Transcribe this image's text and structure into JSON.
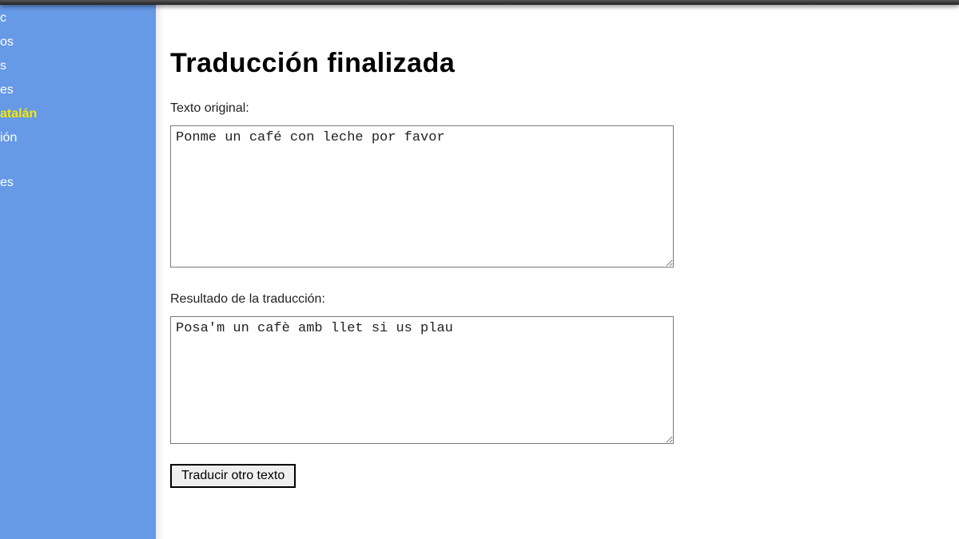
{
  "sidebar": {
    "items": [
      {
        "label": "c",
        "active": false
      },
      {
        "label": "os",
        "active": false
      },
      {
        "label": "s",
        "active": false
      },
      {
        "label": "es",
        "active": false
      },
      {
        "label": "atalán",
        "active": true
      },
      {
        "label": "ión",
        "active": false
      },
      {
        "label": "",
        "active": false,
        "gap": true
      },
      {
        "label": "es",
        "active": false
      }
    ]
  },
  "main": {
    "title": "Traducción finalizada",
    "original_label": "Texto original:",
    "original_text": "Ponme un café con leche por favor",
    "result_label": "Resultado de la traducción:",
    "result_text": "Posa'm un cafè amb llet si us plau",
    "translate_button": "Traducir otro texto"
  }
}
